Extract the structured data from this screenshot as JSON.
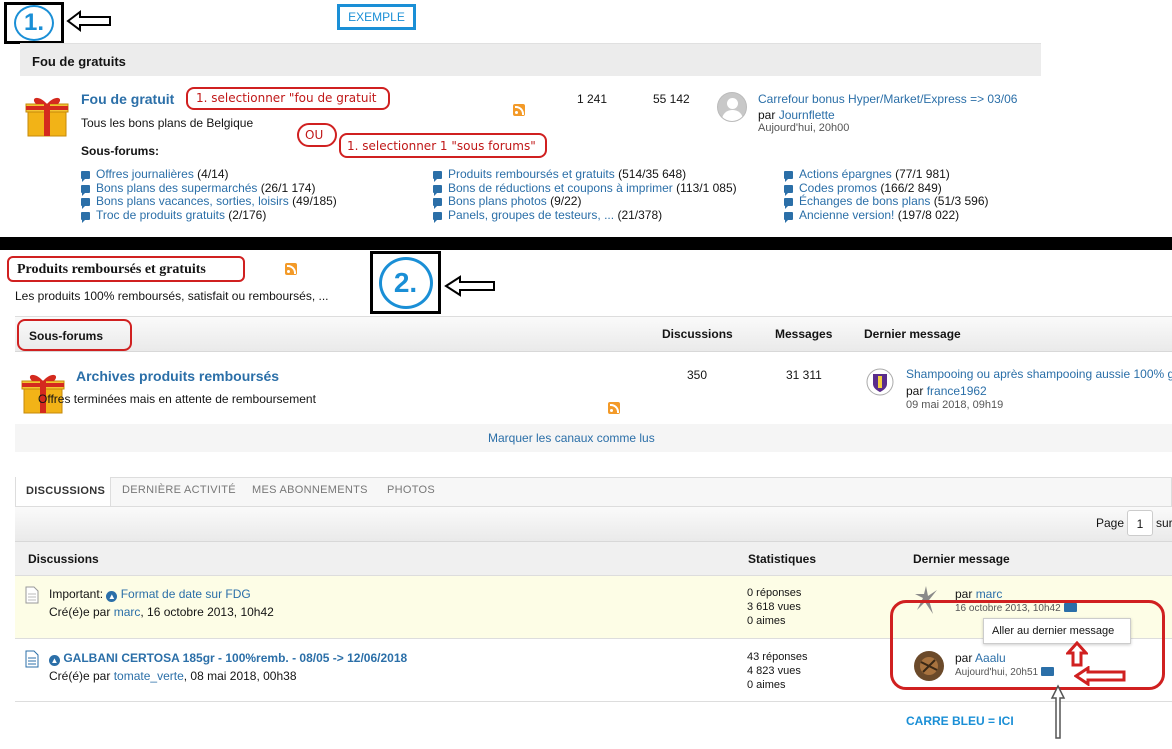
{
  "annotations": {
    "step1": "1.",
    "step2": "2.",
    "example": "EXEMPLE",
    "note_select_fou": "1. selectionner \"fou de gratuit",
    "note_ou": "OU",
    "note_select_sous": "1. selectionner 1 \"sous forums\"",
    "note_carre_bleu": "CARRE BLEU = ICI"
  },
  "section1": {
    "category_title": "Fou de gratuits",
    "forum": {
      "title": "Fou de gratuit",
      "description": "Tous les bons plans de Belgique",
      "discussions": "1 241",
      "messages": "55 142",
      "last_title": "Carrefour bonus Hyper/Market/Express => 03/06",
      "last_by_prefix": "par",
      "last_by": "Journflette",
      "last_time": "Aujourd'hui, 20h00"
    },
    "subforums_label": "Sous-forums:",
    "subforums": [
      {
        "name": "Offres journalières",
        "count": "(4/14)"
      },
      {
        "name": "Bons plans des supermarchés",
        "count": "(26/1 174)"
      },
      {
        "name": "Bons plans vacances, sorties, loisirs",
        "count": "(49/185)"
      },
      {
        "name": "Troc de produits gratuits",
        "count": "(2/176)"
      },
      {
        "name": "Produits remboursés et gratuits",
        "count": "(514/35 648)"
      },
      {
        "name": "Bons de réductions et coupons à imprimer",
        "count": "(113/1 085)"
      },
      {
        "name": "Bons plans photos",
        "count": "(9/22)"
      },
      {
        "name": "Panels, groupes de testeurs, ...",
        "count": "(21/378)"
      },
      {
        "name": "Actions épargnes",
        "count": "(77/1 981)"
      },
      {
        "name": "Codes promos",
        "count": "(166/2 849)"
      },
      {
        "name": "Échanges de bons plans",
        "count": "(51/3 596)"
      },
      {
        "name": "Ancienne version!",
        "count": "(197/8 022)"
      }
    ]
  },
  "section2": {
    "title": "Produits remboursés et gratuits",
    "description": "Les produits 100% remboursés, satisfait ou remboursés, ...",
    "table_header": {
      "subforums": "Sous-forums",
      "discussions": "Discussions",
      "messages": "Messages",
      "last": "Dernier message"
    },
    "archive": {
      "title": "Archives produits remboursés",
      "description": "Offres terminées mais en attente de remboursement",
      "discussions": "350",
      "messages": "31 311",
      "last_title": "Shampooing ou après shampooing aussie 100% g",
      "last_by_prefix": "par",
      "last_by": "france1962",
      "last_time": "09 mai 2018, 09h19"
    },
    "mark_read": "Marquer les canaux comme lus",
    "tabs": [
      "DISCUSSIONS",
      "DERNIÈRE ACTIVITÉ",
      "MES ABONNEMENTS",
      "PHOTOS"
    ],
    "pager": {
      "label": "Page",
      "value": "1",
      "suffix": "sur"
    },
    "list_header": {
      "discussions": "Discussions",
      "stats": "Statistiques",
      "last": "Dernier message"
    },
    "rows": [
      {
        "prefix": "Important:",
        "title": "Format de date sur FDG",
        "created_prefix": "Cré(é)e par",
        "author": "marc",
        "created_date": ", 16 octobre 2013, 10h42",
        "replies": "0 réponses",
        "views": "3 618 vues",
        "likes": "0 aimes",
        "last_by_prefix": "par",
        "last_by": "marc",
        "last_time": "16 octobre 2013, 10h42"
      },
      {
        "prefix": "",
        "title": "GALBANI CERTOSA 185gr - 100%remb. - 08/05 -> 12/06/2018",
        "created_prefix": "Cré(é)e par",
        "author": "tomate_verte",
        "created_date": ", 08 mai 2018, 00h38",
        "replies": "43 réponses",
        "views": "4 823 vues",
        "likes": "0 aimes",
        "last_by_prefix": "par",
        "last_by": "Aaalu",
        "last_time": "Aujourd'hui, 20h51"
      }
    ],
    "tooltip": "Aller au dernier message"
  },
  "colors": {
    "link": "#2b6fa8",
    "annotation_red": "#d02020",
    "annotation_blue": "#1a8fd6"
  }
}
